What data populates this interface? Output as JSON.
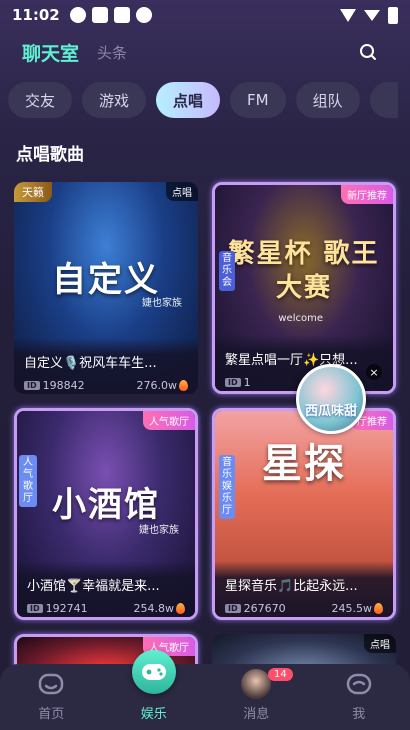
{
  "status_bar": {
    "time": "11:02"
  },
  "header": {
    "title": "聊天室",
    "sub_tab": "头条",
    "search_icon": "search-icon"
  },
  "categories": [
    {
      "label": "交友"
    },
    {
      "label": "游戏"
    },
    {
      "label": "点唱",
      "active": true
    },
    {
      "label": "FM"
    },
    {
      "label": "组队"
    }
  ],
  "section_title": "点唱歌曲",
  "cards": [
    {
      "left_tag": "天籁",
      "corner_tag": "点唱",
      "art_text": "自定义",
      "art_sub": "婕也家族",
      "name": "自定义🎙️祝风车车生...",
      "id_label": "ID",
      "room_id": "198842",
      "heat": "276.0w"
    },
    {
      "corner_tag": "新厅推荐",
      "art_text": "繁星杯 歌王大赛",
      "art_sub": "welcome",
      "side_label": "音乐会",
      "name": "繁星点唱一厅✨只想...",
      "id_label": "ID",
      "room_id": "",
      "heat": "1",
      "framed": true
    },
    {
      "corner_tag": "人气歌厅",
      "art_text": "小酒馆",
      "art_sub": "婕也家族",
      "side_label": "人气歌厅",
      "name": "小酒馆🍸幸福就是来...",
      "id_label": "ID",
      "room_id": "192741",
      "heat": "254.8w",
      "framed": true
    },
    {
      "corner_tag": "厅推荐",
      "art_text": "星探",
      "side_label": "音乐娱乐厅",
      "name": "星探音乐🎵比起永远...",
      "id_label": "ID",
      "room_id": "267670",
      "heat": "245.5w",
      "framed": true
    },
    {
      "corner_tag": "人气歌厅",
      "framed": true
    },
    {
      "corner_tag": "点唱"
    }
  ],
  "bubble": {
    "label": "西瓜味甜"
  },
  "bottom_nav": [
    {
      "label": "首页",
      "icon": "home-icon"
    },
    {
      "label": "娱乐",
      "icon": "gamepad-icon",
      "active": true
    },
    {
      "label": "消息",
      "icon": "avatar",
      "badge": "14"
    },
    {
      "label": "我",
      "icon": "profile-icon"
    }
  ],
  "colors": {
    "accent": "#5ff0d0",
    "bg": "#231f3b",
    "tab_active_from": "#b6f0ff",
    "tab_active_to": "#c6b9ff"
  }
}
